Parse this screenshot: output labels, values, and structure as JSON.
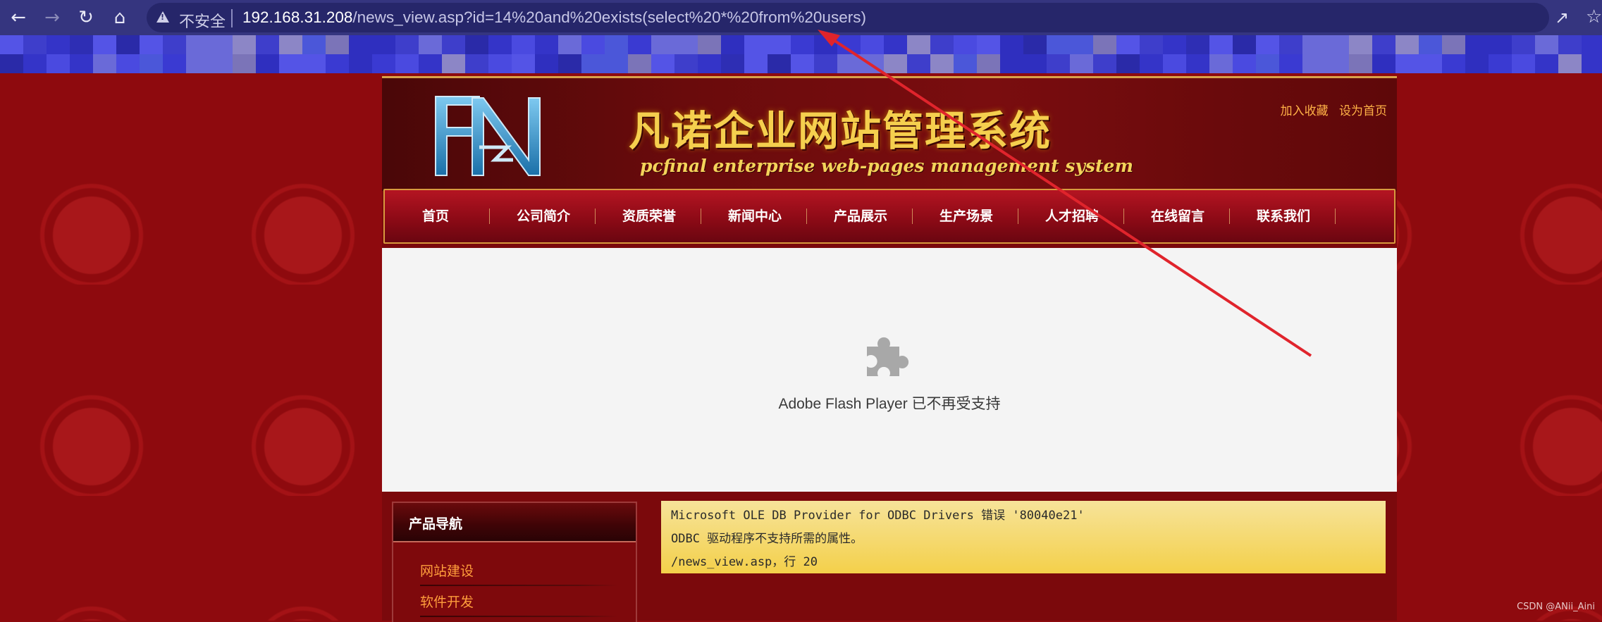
{
  "browser": {
    "security_label": "不安全",
    "url_host": "192.168.31.208",
    "url_path": "/news_view.asp?id=14%20and%20exists(select%20*%20from%20users)",
    "icons": [
      "back-icon",
      "forward-icon",
      "reload-icon",
      "home-icon",
      "warning-icon",
      "share-icon",
      "star-icon"
    ]
  },
  "site": {
    "title_cn": "凡诺企业网站管理系统",
    "title_en": "pcfinal enterprise web-pages management system",
    "logo_text": "FN",
    "top_links": [
      "加入收藏",
      "设为首页"
    ],
    "menu": [
      "首页",
      "公司简介",
      "资质荣誉",
      "新闻中心",
      "产品展示",
      "生产场景",
      "人才招聘",
      "在线留言",
      "联系我们"
    ]
  },
  "flash": {
    "message": "Adobe Flash Player 已不再受支持",
    "icon": "puzzle-icon"
  },
  "sidebar": {
    "title": "产品导航",
    "links": [
      "网站建设",
      "软件开发"
    ]
  },
  "error": {
    "lines": [
      "Microsoft OLE DB Provider for ODBC Drivers 错误 '80040e21'",
      "ODBC 驱动程序不支持所需的属性。",
      "/news_view.asp，行 20"
    ]
  },
  "watermark": "CSDN @ANii_Aini",
  "colors": {
    "page_bg": "#8e0a0e",
    "chrome": "#35357f",
    "arrow": "#e0242c",
    "error_bg": "#f4d04a"
  }
}
